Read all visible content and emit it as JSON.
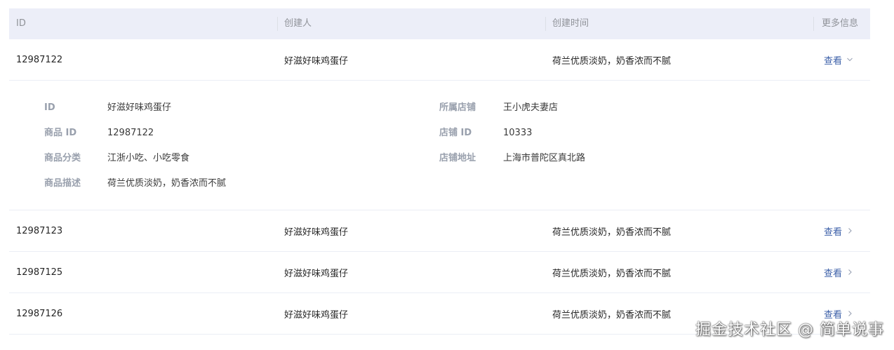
{
  "table": {
    "headers": {
      "id": "ID",
      "creator": "创建人",
      "created_time": "创建时间",
      "more_info": "更多信息"
    },
    "rows": [
      {
        "id": "12987122",
        "creator": "好滋好味鸡蛋仔",
        "description": "荷兰优质淡奶，奶香浓而不腻",
        "action": "查看",
        "expanded": true
      },
      {
        "id": "12987123",
        "creator": "好滋好味鸡蛋仔",
        "description": "荷兰优质淡奶，奶香浓而不腻",
        "action": "查看",
        "expanded": false
      },
      {
        "id": "12987125",
        "creator": "好滋好味鸡蛋仔",
        "description": "荷兰优质淡奶，奶香浓而不腻",
        "action": "查看",
        "expanded": false
      },
      {
        "id": "12987126",
        "creator": "好滋好味鸡蛋仔",
        "description": "荷兰优质淡奶，奶香浓而不腻",
        "action": "查看",
        "expanded": false
      }
    ],
    "expanded_detail": {
      "left": [
        {
          "label": "ID",
          "value": "好滋好味鸡蛋仔"
        },
        {
          "label": "商品 ID",
          "value": "12987122"
        },
        {
          "label": "商品分类",
          "value": "江浙小吃、小吃零食"
        },
        {
          "label": "商品描述",
          "value": "荷兰优质淡奶，奶香浓而不腻"
        }
      ],
      "right": [
        {
          "label": "所属店铺",
          "value": "王小虎夫妻店"
        },
        {
          "label": "店铺 ID",
          "value": "10333"
        },
        {
          "label": "店铺地址",
          "value": "上海市普陀区真北路"
        }
      ]
    }
  },
  "watermark": "掘金技术社区 @ 简单说事",
  "colors": {
    "header_bg": "#eceef8",
    "link": "#3b5fa8",
    "label": "#99a0ad",
    "border": "#ebeef5"
  }
}
